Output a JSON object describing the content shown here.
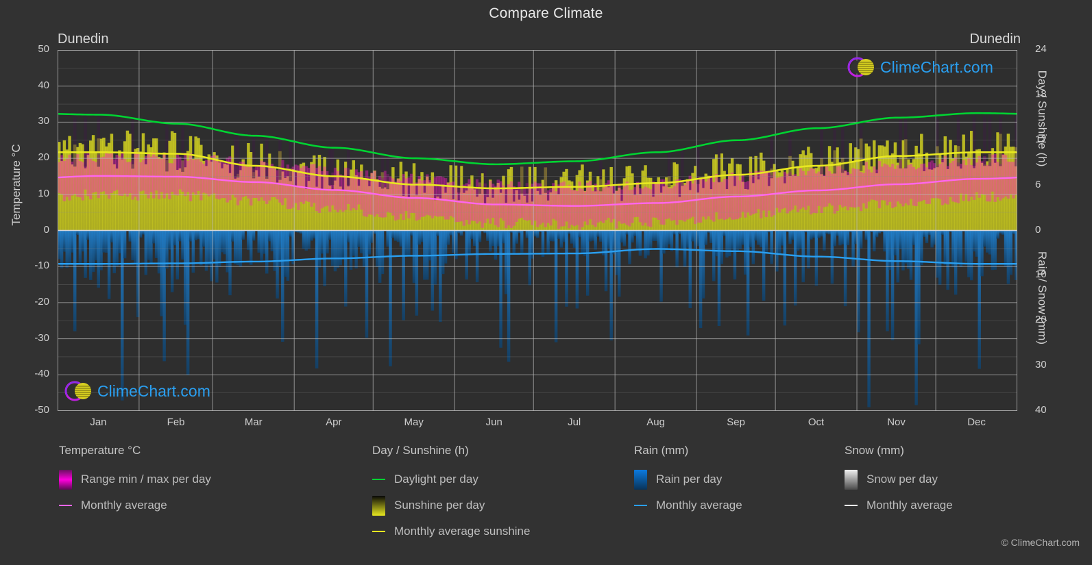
{
  "header": {
    "title": "Compare Climate",
    "location_left": "Dunedin",
    "location_right": "Dunedin"
  },
  "branding": {
    "logo_text": "ClimeChart.com",
    "copyright": "© ClimeChart.com",
    "logo_text_color": "#2a9ff0",
    "logo_ring_color": "#c020e0",
    "logo_sphere_color": "#d8d020"
  },
  "axes": {
    "left_title": "Temperature °C",
    "right_title_top": "Day / Sunshine (h)",
    "right_title_bottom": "Rain / Snow (mm)",
    "left_ticks": [
      "50",
      "40",
      "30",
      "20",
      "10",
      "0",
      "-10",
      "-20",
      "-30",
      "-40",
      "-50"
    ],
    "left_range": [
      -50,
      50
    ],
    "right_ticks_top": [
      "24",
      "18",
      "12",
      "6",
      "0"
    ],
    "right_range_top": [
      0,
      24
    ],
    "right_ticks_bottom": [
      "10",
      "20",
      "30",
      "40"
    ],
    "right_range_bottom": [
      0,
      40
    ],
    "x_ticks": [
      "Jan",
      "Feb",
      "Mar",
      "Apr",
      "May",
      "Jun",
      "Jul",
      "Aug",
      "Sep",
      "Oct",
      "Nov",
      "Dec"
    ],
    "grid": true
  },
  "legend": {
    "groups": [
      {
        "title": "Temperature °C",
        "items": [
          {
            "label": "Range min / max per day",
            "marker": "gradient-box",
            "color": "#ff00dd"
          },
          {
            "label": "Monthly average",
            "marker": "line",
            "color": "#ff66ee"
          }
        ]
      },
      {
        "title": "Day / Sunshine (h)",
        "items": [
          {
            "label": "Daylight per day",
            "marker": "line",
            "color": "#00d432"
          },
          {
            "label": "Sunshine per day",
            "marker": "gradient-box",
            "color": "#e8e820"
          },
          {
            "label": "Monthly average sunshine",
            "marker": "line",
            "color": "#e8e820"
          }
        ]
      },
      {
        "title": "Rain (mm)",
        "items": [
          {
            "label": "Rain per day",
            "marker": "gradient-box",
            "color": "#0b7ae0"
          },
          {
            "label": "Monthly average",
            "marker": "line",
            "color": "#2a9ff0"
          }
        ]
      },
      {
        "title": "Snow (mm)",
        "items": [
          {
            "label": "Snow per day",
            "marker": "gradient-box",
            "color": "#f0f0f0"
          },
          {
            "label": "Monthly average",
            "marker": "line",
            "color": "#ffffff"
          }
        ]
      }
    ]
  },
  "chart_data": {
    "type": "line",
    "title": "Compare Climate",
    "subtitle": "Dunedin",
    "xlabel": "",
    "ylabel": "Temperature °C",
    "categories": [
      "Jan",
      "Feb",
      "Mar",
      "Apr",
      "May",
      "Jun",
      "Jul",
      "Aug",
      "Sep",
      "Oct",
      "Nov",
      "Dec"
    ],
    "ylim": [
      -50,
      50
    ],
    "y2lim_day": [
      0,
      24
    ],
    "y2lim_rain": [
      0,
      40
    ],
    "grid": true,
    "legend_position": "below",
    "series": [
      {
        "name": "Daylight per day",
        "unit": "h",
        "axis": "right-day",
        "color": "#00d432",
        "values": [
          15.4,
          14.2,
          12.6,
          11.0,
          9.6,
          8.8,
          9.2,
          10.4,
          12.0,
          13.6,
          15.0,
          15.6
        ]
      },
      {
        "name": "Monthly average sunshine",
        "unit": "h",
        "axis": "right-day",
        "color": "#e8e820",
        "values": [
          10.4,
          10.2,
          8.6,
          7.2,
          6.1,
          5.6,
          5.8,
          6.3,
          7.4,
          8.6,
          9.9,
          10.4
        ]
      },
      {
        "name": "Monthly average temperature",
        "unit": "°C",
        "axis": "left",
        "color": "#ff66ee",
        "values": [
          15.1,
          14.9,
          13.4,
          11.2,
          9.0,
          7.2,
          6.8,
          7.6,
          9.4,
          11.1,
          12.8,
          14.3
        ]
      },
      {
        "name": "Monthly average rain",
        "unit": "mm",
        "axis": "right-rain",
        "color": "#2a9ff0",
        "values": [
          7.4,
          7.3,
          6.9,
          6.2,
          5.6,
          5.2,
          5.1,
          4.1,
          4.6,
          5.8,
          6.8,
          7.4
        ]
      }
    ],
    "daily_bands": [
      {
        "name": "Temperature range min / max per day",
        "color": "#ff00dd",
        "note": "magenta daily min/max band around the monthly average"
      },
      {
        "name": "Sunshine per day",
        "color": "#e8e820",
        "note": "yellow daily sunshine bars from 0 upward"
      },
      {
        "name": "Rain per day",
        "color": "#0b7ae0",
        "note": "blue daily rain bars from 0 downward"
      },
      {
        "name": "Snow per day",
        "color": "#f0f0f0",
        "note": "white/grey daily snow bars from 0 downward"
      }
    ]
  }
}
